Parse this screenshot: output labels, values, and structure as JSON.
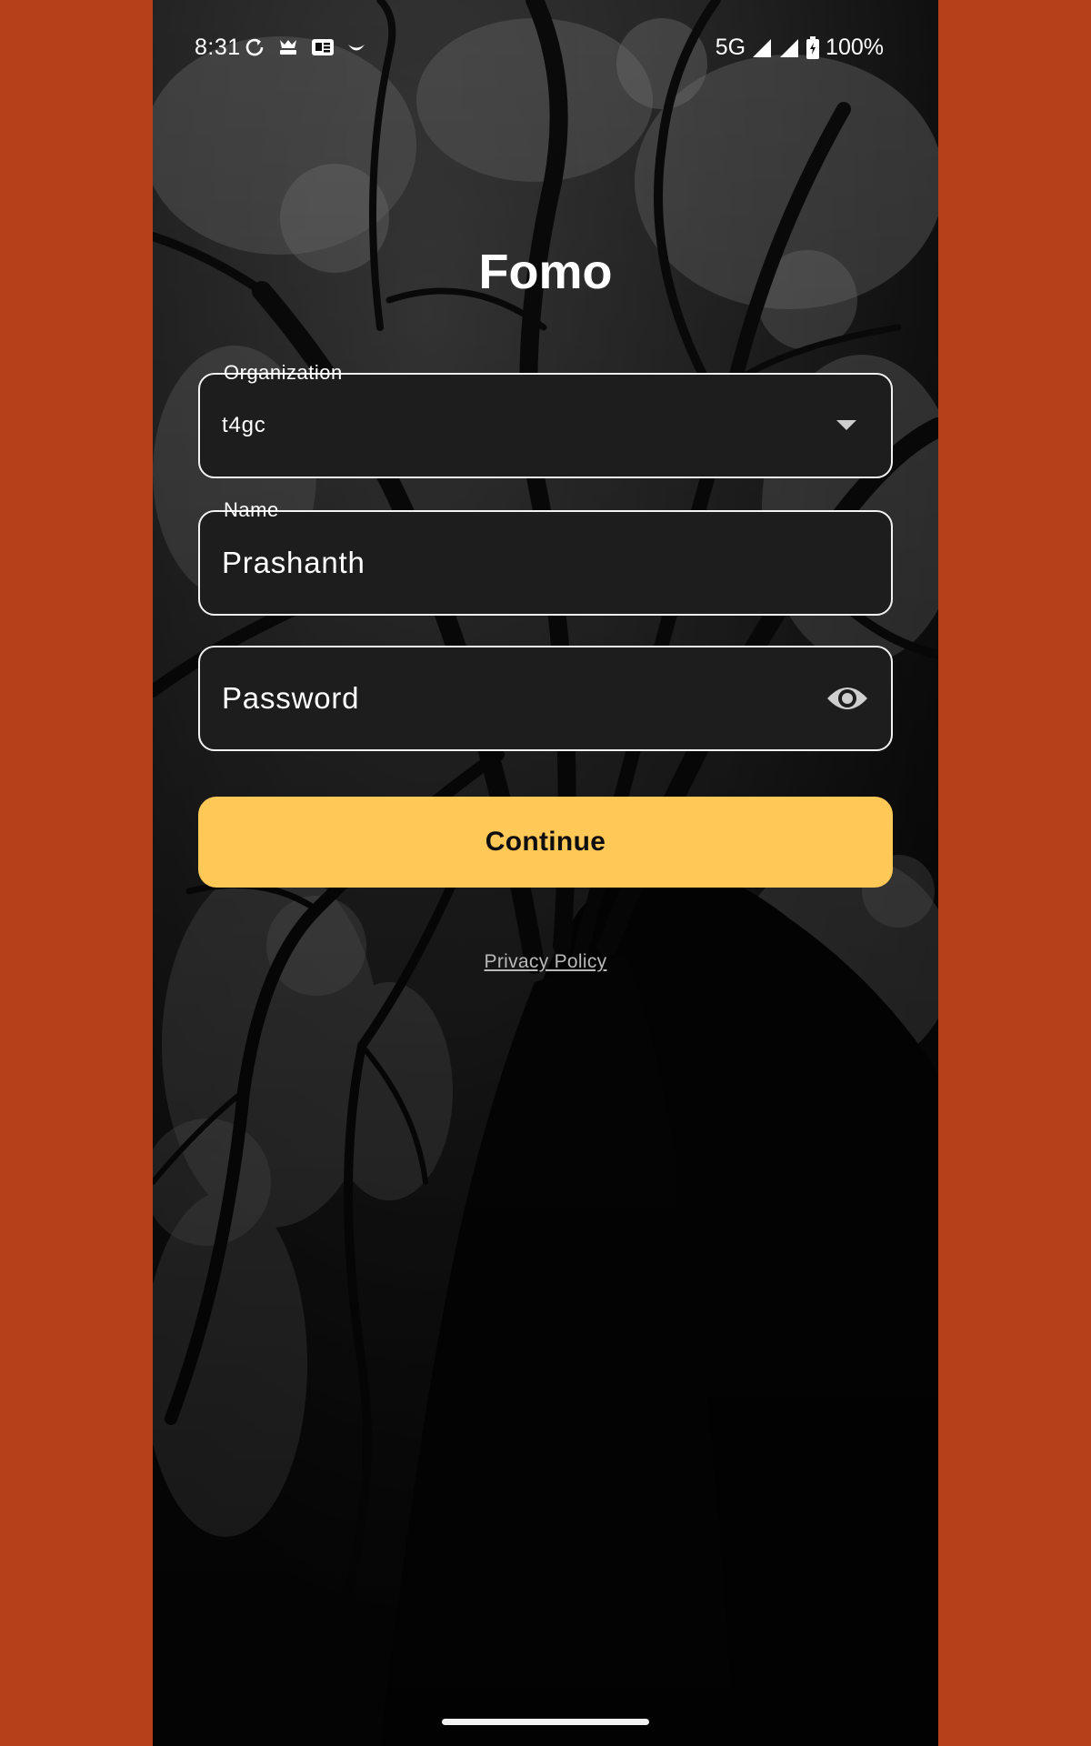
{
  "status_bar": {
    "time": "8:31",
    "left_icons": [
      "sync-icon",
      "fool-app-icon",
      "news-icon",
      "smile-icon"
    ],
    "network": "5G",
    "signal_icons": [
      "signal-icon",
      "signal-icon"
    ],
    "battery_icon": "battery-icon",
    "battery_percent": "100%"
  },
  "app": {
    "title": "Fomo"
  },
  "form": {
    "organization": {
      "label": "Organization",
      "value": "t4gc",
      "icon": "dropdown-arrow-icon"
    },
    "name": {
      "label": "Name",
      "value": "Prashanth"
    },
    "password": {
      "placeholder": "Password",
      "value": "",
      "icon": "eye-icon"
    },
    "continue_label": "Continue"
  },
  "footer": {
    "privacy_label": "Privacy Policy"
  },
  "colors": {
    "accent": "#FFC857",
    "outer_background": "#B5401A",
    "field_background": "#1D1D1E",
    "field_border": "#F2F2F2",
    "link": "#B9B9B9"
  }
}
